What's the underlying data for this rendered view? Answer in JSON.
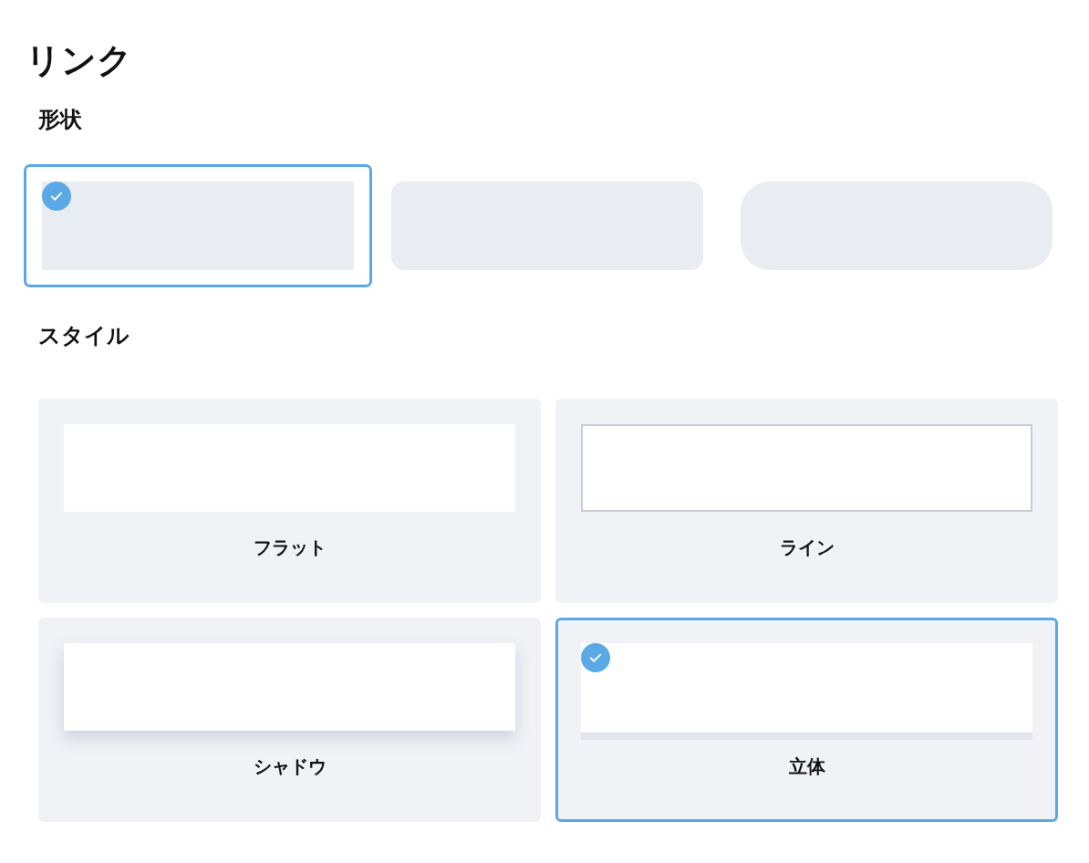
{
  "title": "リンク",
  "shape": {
    "heading": "形状",
    "options": [
      {
        "kind": "square",
        "selected": true
      },
      {
        "kind": "rounded",
        "selected": false
      },
      {
        "kind": "pill",
        "selected": false
      }
    ]
  },
  "style": {
    "heading": "スタイル",
    "options": [
      {
        "kind": "flat",
        "label": "フラット",
        "selected": false
      },
      {
        "kind": "line",
        "label": "ライン",
        "selected": false
      },
      {
        "kind": "shadow",
        "label": "シャドウ",
        "selected": false
      },
      {
        "kind": "solid",
        "label": "立体",
        "selected": true
      }
    ]
  }
}
